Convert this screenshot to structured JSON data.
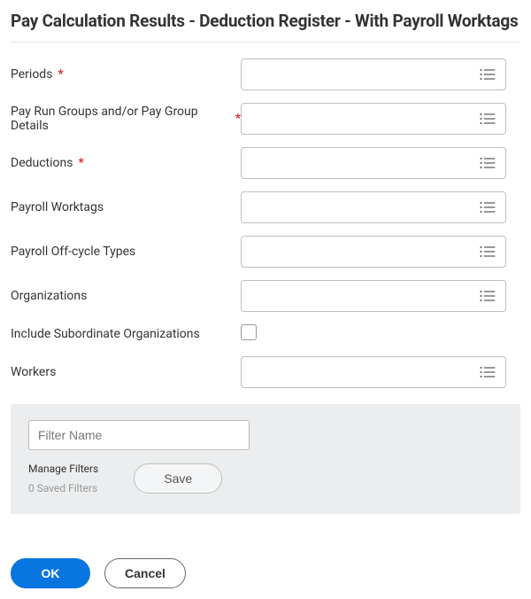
{
  "header": {
    "title": "Pay Calculation Results - Deduction Register - With Payroll Worktags"
  },
  "form": {
    "fields": [
      {
        "label": "Periods",
        "required": true,
        "type": "prompt",
        "value": ""
      },
      {
        "label": "Pay Run Groups and/or Pay Group Details",
        "required": true,
        "type": "prompt",
        "value": ""
      },
      {
        "label": "Deductions",
        "required": true,
        "type": "prompt",
        "value": ""
      },
      {
        "label": "Payroll Worktags",
        "required": false,
        "type": "prompt",
        "value": ""
      },
      {
        "label": "Payroll Off-cycle Types",
        "required": false,
        "type": "prompt",
        "value": ""
      },
      {
        "label": "Organizations",
        "required": false,
        "type": "prompt",
        "value": ""
      },
      {
        "label": "Include Subordinate Organizations",
        "required": false,
        "type": "checkbox",
        "value": false
      },
      {
        "label": "Workers",
        "required": false,
        "type": "prompt",
        "value": ""
      }
    ]
  },
  "filters": {
    "name_placeholder": "Filter Name",
    "name_value": "",
    "manage_label": "Manage Filters",
    "saved_count_label": "0 Saved Filters",
    "save_label": "Save"
  },
  "actions": {
    "ok_label": "OK",
    "cancel_label": "Cancel"
  },
  "required_marker": "*"
}
